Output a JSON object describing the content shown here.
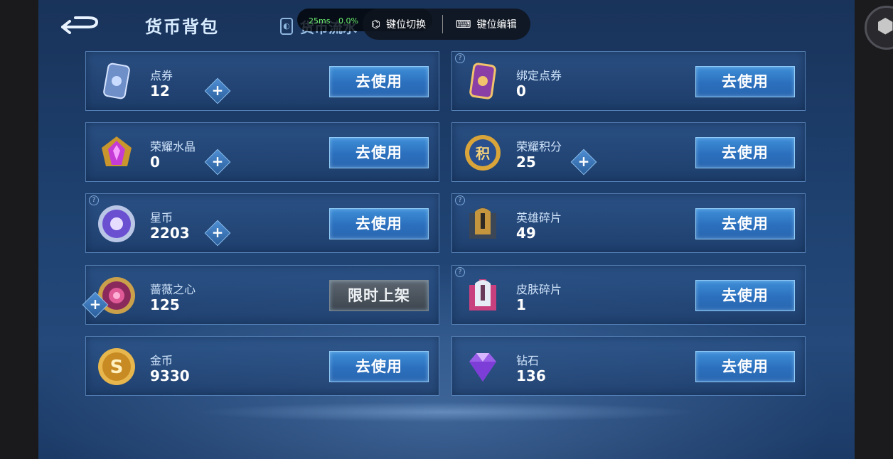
{
  "header": {
    "title": "货币背包",
    "flow_tab": "货币流水"
  },
  "overlay": {
    "ping_ms": "25ms",
    "ping_pct": "0.0%",
    "switch_label": "键位切换",
    "edit_label": "键位编辑"
  },
  "currencies": [
    {
      "name": "点券",
      "count": "12",
      "button": "去使用",
      "has_plus": true,
      "has_info": false,
      "icon": "coupon-icon"
    },
    {
      "name": "绑定点券",
      "count": "0",
      "button": "去使用",
      "has_plus": false,
      "has_info": true,
      "icon": "bound-coupon-icon"
    },
    {
      "name": "荣耀水晶",
      "count": "0",
      "button": "去使用",
      "has_plus": true,
      "has_info": false,
      "icon": "glory-crystal-icon"
    },
    {
      "name": "荣耀积分",
      "count": "25",
      "button": "去使用",
      "has_plus": true,
      "has_info": false,
      "icon": "glory-points-icon"
    },
    {
      "name": "星币",
      "count": "2203",
      "button": "去使用",
      "has_plus": true,
      "has_info": true,
      "icon": "star-coin-icon"
    },
    {
      "name": "英雄碎片",
      "count": "49",
      "button": "去使用",
      "has_plus": false,
      "has_info": true,
      "icon": "hero-fragment-icon"
    },
    {
      "name": "蔷薇之心",
      "count": "125",
      "button": "限时上架",
      "has_plus": true,
      "has_info": false,
      "icon": "rose-heart-icon"
    },
    {
      "name": "皮肤碎片",
      "count": "1",
      "button": "去使用",
      "has_plus": false,
      "has_info": true,
      "icon": "skin-fragment-icon"
    },
    {
      "name": "金币",
      "count": "9330",
      "button": "去使用",
      "has_plus": false,
      "has_info": false,
      "icon": "gold-coin-icon"
    },
    {
      "name": "钻石",
      "count": "136",
      "button": "去使用",
      "has_plus": false,
      "has_info": false,
      "icon": "diamond-icon"
    }
  ],
  "colors": {
    "accent": "#3f8fd8",
    "panel_border": "#78aae1",
    "background": "#1e4170"
  }
}
